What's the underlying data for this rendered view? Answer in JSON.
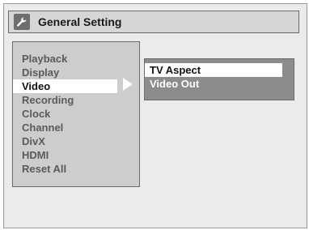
{
  "header": {
    "title": "General Setting",
    "icon": "wrench-icon"
  },
  "menu": {
    "items": [
      {
        "label": "Playback",
        "selected": false
      },
      {
        "label": "Display",
        "selected": false
      },
      {
        "label": "Video",
        "selected": true
      },
      {
        "label": "Recording",
        "selected": false
      },
      {
        "label": "Clock",
        "selected": false
      },
      {
        "label": "Channel",
        "selected": false
      },
      {
        "label": "DivX",
        "selected": false
      },
      {
        "label": "HDMI",
        "selected": false
      },
      {
        "label": "Reset All",
        "selected": false
      }
    ]
  },
  "submenu": {
    "items": [
      {
        "label": "TV Aspect",
        "selected": true
      },
      {
        "label": "Video Out",
        "selected": false
      }
    ]
  },
  "colors": {
    "background": "#ebebeb",
    "panel": "#cdcdcd",
    "subpanel": "#8c8c8c",
    "highlight": "#ffffff"
  }
}
